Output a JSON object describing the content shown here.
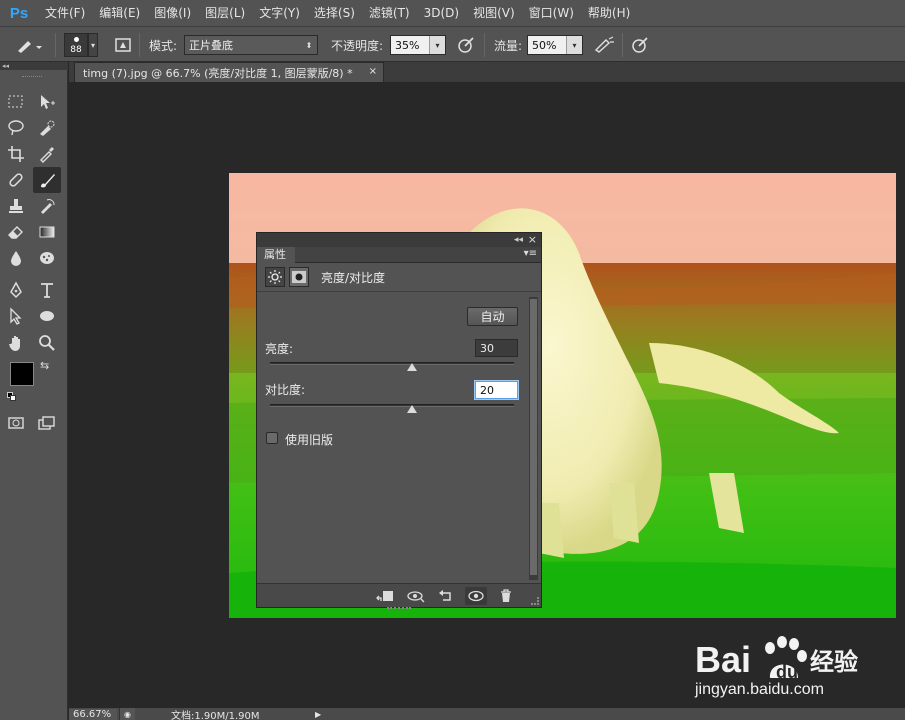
{
  "app": {
    "logo": "Ps"
  },
  "menu": [
    "文件(F)",
    "编辑(E)",
    "图像(I)",
    "图层(L)",
    "文字(Y)",
    "选择(S)",
    "滤镜(T)",
    "3D(D)",
    "视图(V)",
    "窗口(W)",
    "帮助(H)"
  ],
  "options": {
    "brush_size": "88",
    "mode_label": "模式:",
    "mode_value": "正片叠底",
    "opacity_label": "不透明度:",
    "opacity_value": "35%",
    "flow_label": "流量:",
    "flow_value": "50%"
  },
  "document": {
    "tab_title": "timg (7).jpg @ 66.7% (亮度/对比度 1, 图层蒙版/8) *",
    "tab_close": "×"
  },
  "status": {
    "zoom": "66.67%",
    "doc_info": "文档:1.90M/1.90M"
  },
  "panel": {
    "tab_label": "属性",
    "collapse_glyph": "◂◂",
    "close_glyph": "×",
    "title": "亮度/对比度",
    "auto_button": "自动",
    "brightness_label": "亮度:",
    "brightness_value": "30",
    "brightness_fraction": 0.58,
    "contrast_label": "对比度:",
    "contrast_value": "20",
    "contrast_fraction": 0.58,
    "legacy_label": "使用旧版",
    "legacy_checked": false
  },
  "watermark": {
    "brand": "Bai",
    "brand_cn": "经验",
    "url": "jingyan.baidu.com"
  },
  "colors": {
    "foreground": "#000000",
    "background": "#ffffff",
    "accent_ps": "#31a8ff"
  }
}
